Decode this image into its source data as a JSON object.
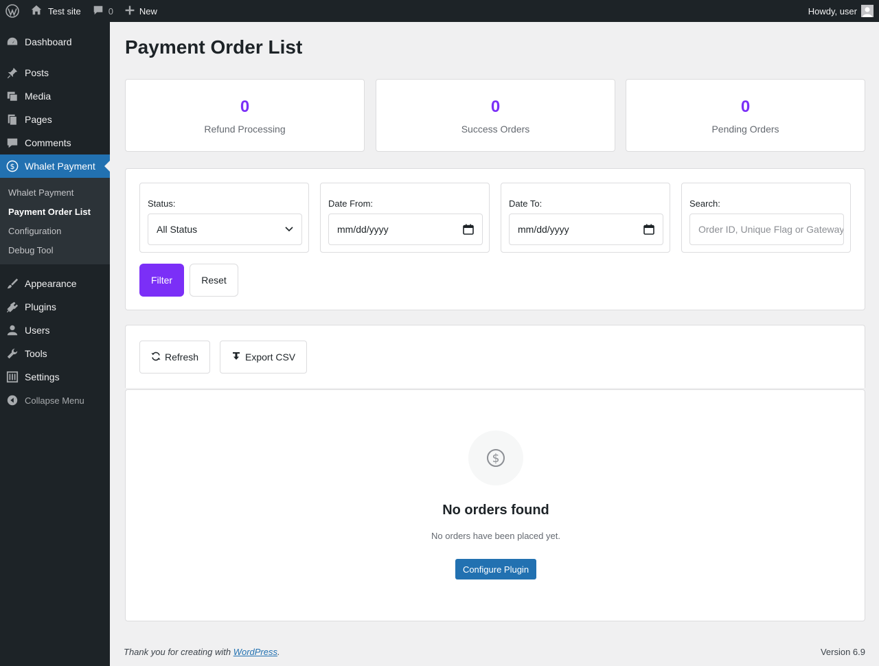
{
  "adminbar": {
    "site_name": "Test site",
    "comments_count": "0",
    "new_label": "New",
    "howdy": "Howdy, user"
  },
  "sidebar": {
    "items_top": [
      {
        "label": "Dashboard",
        "icon": "dashboard-icon"
      },
      {
        "label": "Posts",
        "icon": "pin-icon"
      },
      {
        "label": "Media",
        "icon": "media-icon"
      },
      {
        "label": "Pages",
        "icon": "pages-icon"
      },
      {
        "label": "Comments",
        "icon": "comments-icon"
      },
      {
        "label": "Whalet Payment",
        "icon": "dollar-circle-icon"
      }
    ],
    "submenu": [
      {
        "label": "Whalet Payment"
      },
      {
        "label": "Payment Order List"
      },
      {
        "label": "Configuration"
      },
      {
        "label": "Debug Tool"
      }
    ],
    "items_bottom": [
      {
        "label": "Appearance",
        "icon": "brush-icon"
      },
      {
        "label": "Plugins",
        "icon": "plugin-icon"
      },
      {
        "label": "Users",
        "icon": "user-icon"
      },
      {
        "label": "Tools",
        "icon": "wrench-icon"
      },
      {
        "label": "Settings",
        "icon": "settings-icon"
      }
    ],
    "collapse_label": "Collapse Menu"
  },
  "page": {
    "title": "Payment Order List"
  },
  "stats": [
    {
      "value": "0",
      "label": "Refund Processing"
    },
    {
      "value": "0",
      "label": "Success Orders"
    },
    {
      "value": "0",
      "label": "Pending Orders"
    }
  ],
  "filters": {
    "status_label": "Status:",
    "status_value": "All Status",
    "date_from_label": "Date From:",
    "date_from_value": "mm/dd/yyyy",
    "date_to_label": "Date To:",
    "date_to_value": "mm/dd/yyyy",
    "search_label": "Search:",
    "search_placeholder": "Order ID, Unique Flag or Gateway",
    "filter_button": "Filter",
    "reset_button": "Reset"
  },
  "actions": {
    "refresh": "Refresh",
    "export": "Export CSV"
  },
  "empty": {
    "title": "No orders found",
    "description": "No orders have been placed yet.",
    "button": "Configure Plugin"
  },
  "footer": {
    "thanks_prefix": "Thank you for creating with ",
    "thanks_link": "WordPress",
    "thanks_suffix": ".",
    "version": "Version 6.9"
  },
  "colors": {
    "accent": "#7b2ff7",
    "wp_blue": "#2271b1",
    "sidebar_bg": "#1d2327"
  }
}
